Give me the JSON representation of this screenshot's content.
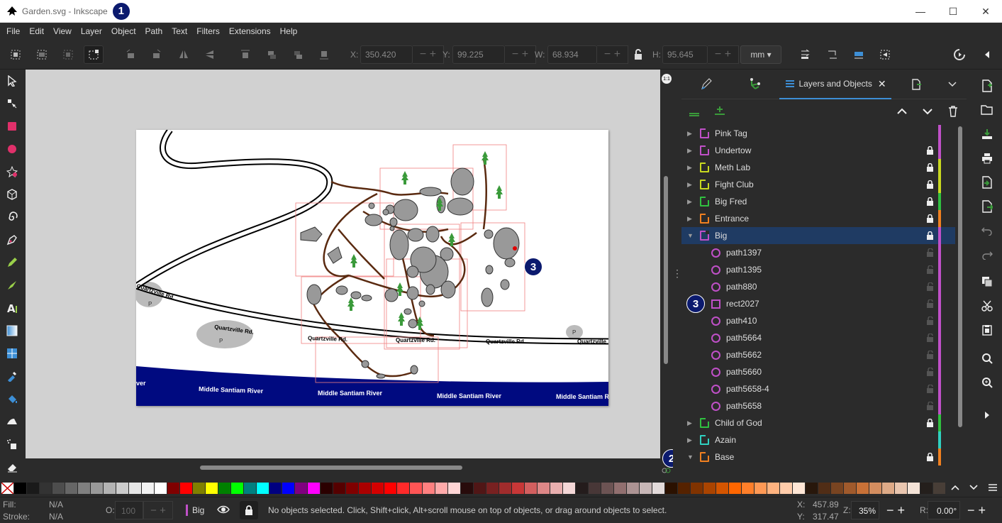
{
  "window": {
    "title": "Garden.svg - Inkscape",
    "badge1": "1",
    "badge2": "2",
    "badge3": "3"
  },
  "menu": [
    "File",
    "Edit",
    "View",
    "Layer",
    "Object",
    "Path",
    "Text",
    "Filters",
    "Extensions",
    "Help"
  ],
  "toolbar": {
    "x_label": "X:",
    "x_value": "350.420",
    "y_label": "Y:",
    "y_value": "99.225",
    "w_label": "W:",
    "w_value": "68.934",
    "h_label": "H:",
    "h_value": "95.645",
    "unit": "mm"
  },
  "map": {
    "road_labels": [
      "Quartzville Rd.",
      "Quartzville Rd.",
      "Quartzville Rd.",
      "Quartzville Rd.",
      "Quartzville Rd.",
      "Quartzville"
    ],
    "river_labels": [
      "ver",
      "Middle Santiam River",
      "Middle Santiam River",
      "Middle Santiam River",
      "Middle Santiam R"
    ],
    "parking": "P"
  },
  "panel": {
    "tab_label": "Layers and Objects",
    "layers": [
      {
        "name": "Pink Tag",
        "color": "#c050c8",
        "locked": false,
        "expanded": false
      },
      {
        "name": "Undertow",
        "color": "#c050c8",
        "locked": true,
        "expanded": false
      },
      {
        "name": "Meth Lab",
        "color": "#c8d820",
        "locked": true,
        "expanded": false
      },
      {
        "name": "Fight Club",
        "color": "#c8d820",
        "locked": true,
        "expanded": false
      },
      {
        "name": "Big Fred",
        "color": "#30c040",
        "locked": true,
        "expanded": false
      },
      {
        "name": "Entrance",
        "color": "#f08020",
        "locked": true,
        "expanded": false
      },
      {
        "name": "Big",
        "color": "#c050c8",
        "locked": true,
        "expanded": true,
        "selected": true
      },
      {
        "name": "path1397",
        "child": true,
        "shape": "circle",
        "color": "#c050c8"
      },
      {
        "name": "path1395",
        "child": true,
        "shape": "circle",
        "color": "#c050c8"
      },
      {
        "name": "path880",
        "child": true,
        "shape": "circle",
        "color": "#c050c8"
      },
      {
        "name": "rect2027",
        "child": true,
        "shape": "rect",
        "color": "#c050c8"
      },
      {
        "name": "path410",
        "child": true,
        "shape": "circle",
        "color": "#c050c8"
      },
      {
        "name": "path5664",
        "child": true,
        "shape": "circle",
        "color": "#c050c8"
      },
      {
        "name": "path5662",
        "child": true,
        "shape": "circle",
        "color": "#c050c8"
      },
      {
        "name": "path5660",
        "child": true,
        "shape": "circle",
        "color": "#c050c8"
      },
      {
        "name": "path5658-4",
        "child": true,
        "shape": "circle",
        "color": "#c050c8"
      },
      {
        "name": "path5658",
        "child": true,
        "shape": "circle",
        "color": "#c050c8"
      },
      {
        "name": "Child of God",
        "color": "#30c040",
        "locked": true,
        "expanded": false
      },
      {
        "name": "Azain",
        "color": "#30d0c0",
        "locked": false,
        "expanded": false
      },
      {
        "name": "Base",
        "color": "#f08020",
        "locked": true,
        "expanded": true
      }
    ]
  },
  "palette": [
    "#000000",
    "#1a1a1a",
    "#333333",
    "#4d4d4d",
    "#666666",
    "#808080",
    "#999999",
    "#b3b3b3",
    "#cccccc",
    "#e6e6e6",
    "#f2f2f2",
    "#ffffff",
    "#800000",
    "#ff0000",
    "#808000",
    "#ffff00",
    "#008000",
    "#00ff00",
    "#008080",
    "#00ffff",
    "#000080",
    "#0000ff",
    "#800080",
    "#ff00ff",
    "#2b0000",
    "#550000",
    "#800000",
    "#aa0000",
    "#d40000",
    "#ff0000",
    "#ff2a2a",
    "#ff5555",
    "#ff8080",
    "#ffaaaa",
    "#ffd5d5",
    "#280b0b",
    "#501616",
    "#782121",
    "#a02c2c",
    "#c83737",
    "#d35f5f",
    "#de8787",
    "#e9afaf",
    "#f4d7d7",
    "#241c1c",
    "#483737",
    "#6c5353",
    "#916f6f",
    "#ac9393",
    "#c8b7b7",
    "#e3dbdb",
    "#2b1100",
    "#552200",
    "#803300",
    "#aa4400",
    "#d45500",
    "#ff6600",
    "#ff7f2a",
    "#ff9955",
    "#ffb380",
    "#ffccaa",
    "#ffe6d5",
    "#28170b",
    "#502d16",
    "#784421",
    "#a05a2c",
    "#c87137",
    "#d38d5f",
    "#deaa87",
    "#e9c6af",
    "#f4e3d7",
    "#241f1c",
    "#483e37",
    "#6c5d53",
    "#917c6f"
  ],
  "status": {
    "fill_label": "Fill:",
    "fill_value": "N/A",
    "stroke_label": "Stroke:",
    "stroke_value": "N/A",
    "opacity_label": "O:",
    "opacity_value": "100",
    "layer_name": "Big",
    "message": "No objects selected. Click, Shift+click, Alt+scroll mouse on top of objects, or drag around objects to select.",
    "x_label": "X:",
    "x_value": "457.89",
    "y_label": "Y:",
    "y_value": "317.47",
    "zoom_label": "Z:",
    "zoom_value": "35%",
    "rot_label": "R:",
    "rot_value": "0.00°"
  }
}
